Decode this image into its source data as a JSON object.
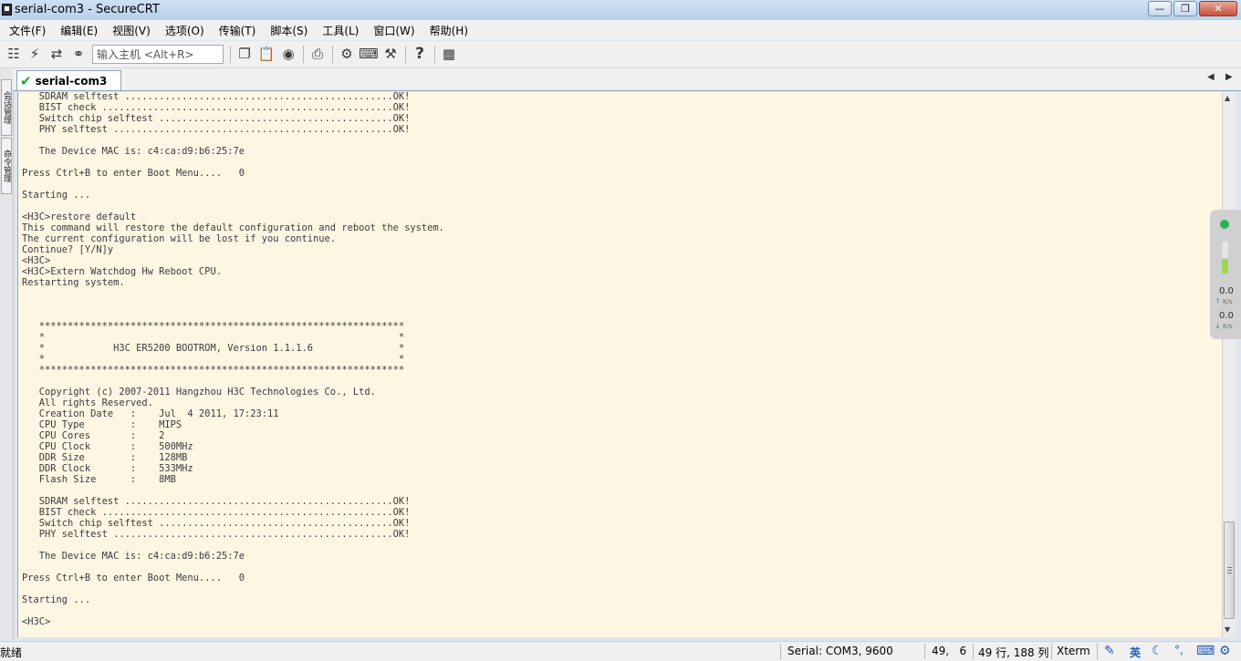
{
  "window": {
    "title": "serial-com3 - SecureCRT"
  },
  "menu": [
    "文件(F)",
    "编辑(E)",
    "视图(V)",
    "选项(O)",
    "传输(T)",
    "脚本(S)",
    "工具(L)",
    "窗口(W)",
    "帮助(H)"
  ],
  "toolbar": {
    "host_placeholder": "输入主机 <Alt+R>"
  },
  "side_tabs": [
    "会话管理",
    "命令管理"
  ],
  "session_tab": {
    "label": "serial-com3"
  },
  "terminal": {
    "lines": [
      "   SDRAM selftest ...............................................OK!",
      "   BIST check ...................................................OK!",
      "   Switch chip selftest .........................................OK!",
      "   PHY selftest .................................................OK!",
      "",
      "   The Device MAC is: c4:ca:d9:b6:25:7e",
      "",
      "Press Ctrl+B to enter Boot Menu....   0",
      "",
      "Starting ...",
      "",
      "<H3C>restore default",
      "This command will restore the default configuration and reboot the system.",
      "The current configuration will be lost if you continue.",
      "Continue? [Y/N]y",
      "<H3C>",
      "<H3C>Extern Watchdog Hw Reboot CPU.",
      "Restarting system.",
      "",
      "",
      "",
      "   ****************************************************************",
      "   *                                                              *",
      "   *            H3C ER5200 BOOTROM, Version 1.1.1.6               *",
      "   *                                                              *",
      "   ****************************************************************",
      "",
      "   Copyright (c) 2007-2011 Hangzhou H3C Technologies Co., Ltd.",
      "   All rights Reserved.",
      "   Creation Date   :    Jul  4 2011, 17:23:11",
      "   CPU Type        :    MIPS",
      "   CPU Cores       :    2",
      "   CPU Clock       :    500MHz",
      "   DDR Size        :    128MB",
      "   DDR Clock       :    533MHz",
      "   Flash Size      :    8MB",
      "",
      "   SDRAM selftest ...............................................OK!",
      "   BIST check ...................................................OK!",
      "   Switch chip selftest .........................................OK!",
      "   PHY selftest .................................................OK!",
      "",
      "   The Device MAC is: c4:ca:d9:b6:25:7e",
      "",
      "Press Ctrl+B to enter Boot Menu....   0",
      "",
      "Starting ...",
      "",
      "<H3C>"
    ]
  },
  "net_meter": {
    "upload": "0.0",
    "download": "0.0",
    "unit": "K/s"
  },
  "status": {
    "ready": "就绪",
    "connection": "Serial: COM3, 9600",
    "cursor": "49,   6",
    "size": "49 行, 188 列",
    "terminal_type": "Xterm",
    "ime": "英"
  }
}
